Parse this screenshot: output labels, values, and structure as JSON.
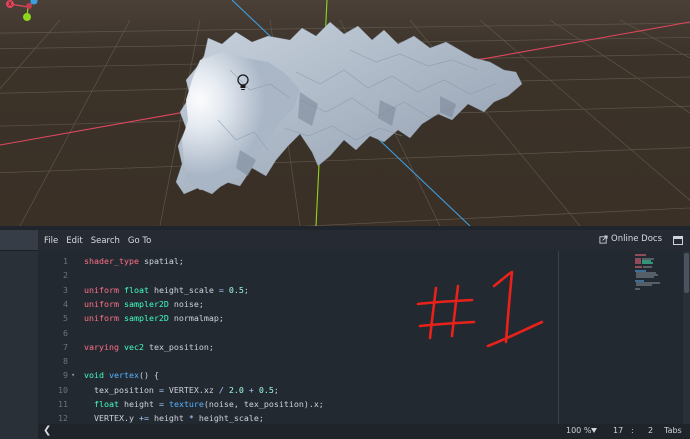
{
  "menu": {
    "items": [
      "File",
      "Edit",
      "Search",
      "Go To"
    ],
    "docs_label": "Online Docs"
  },
  "code": {
    "lines": [
      {
        "n": "1",
        "html": "<span class='kw'>shader_type</span> spatial;"
      },
      {
        "n": "2",
        "html": ""
      },
      {
        "n": "3",
        "html": "<span class='kw'>uniform</span> <span class='ty'>float</span> height_scale <span class='op'>=</span> <span class='num'>0.5</span>;"
      },
      {
        "n": "4",
        "html": "<span class='kw'>uniform</span> <span class='ty'>sampler2D</span> noise;"
      },
      {
        "n": "5",
        "html": "<span class='kw'>uniform</span> <span class='ty'>sampler2D</span> normalmap;"
      },
      {
        "n": "6",
        "html": ""
      },
      {
        "n": "7",
        "html": "<span class='kw'>varying</span> <span class='ty'>vec2</span> tex_position;"
      },
      {
        "n": "8",
        "html": ""
      },
      {
        "n": "9",
        "html": "<span class='ty'>void</span> <span class='fn'>vertex</span>() {",
        "fold": true
      },
      {
        "n": "10",
        "html": "  tex_position <span class='op'>=</span> VERTEX.xz <span class='op'>/</span> <span class='num'>2.0</span> <span class='op'>+</span> <span class='num'>0.5</span>;"
      },
      {
        "n": "11",
        "html": "  <span class='ty'>float</span> height <span class='op'>=</span> <span class='fn'>texture</span>(noise, tex_position).x;"
      },
      {
        "n": "12",
        "html": "  VERTEX.y <span class='op'>+=</span> height <span class='op'>*</span> height_scale;"
      }
    ]
  },
  "status": {
    "left_glyph": "❮",
    "zoom": "100 %",
    "line": "17",
    "colon": ":",
    "column": "2",
    "indent_mode": "Tabs"
  },
  "icons": {
    "viewport_light": "light-bulb-icon",
    "docs": "external-link-icon",
    "layout": "layout-toggle-icon",
    "gizmo": "orientation-gizmo-icon"
  },
  "colors": {
    "keyword": "#ff7085",
    "type": "#42ffc2",
    "function": "#57b3ff",
    "number": "#a1ffe0",
    "x_axis": "#e0475d",
    "y_axis": "#8fd61e",
    "z_axis": "#3d9ee0",
    "annotation": "#e8221a"
  }
}
